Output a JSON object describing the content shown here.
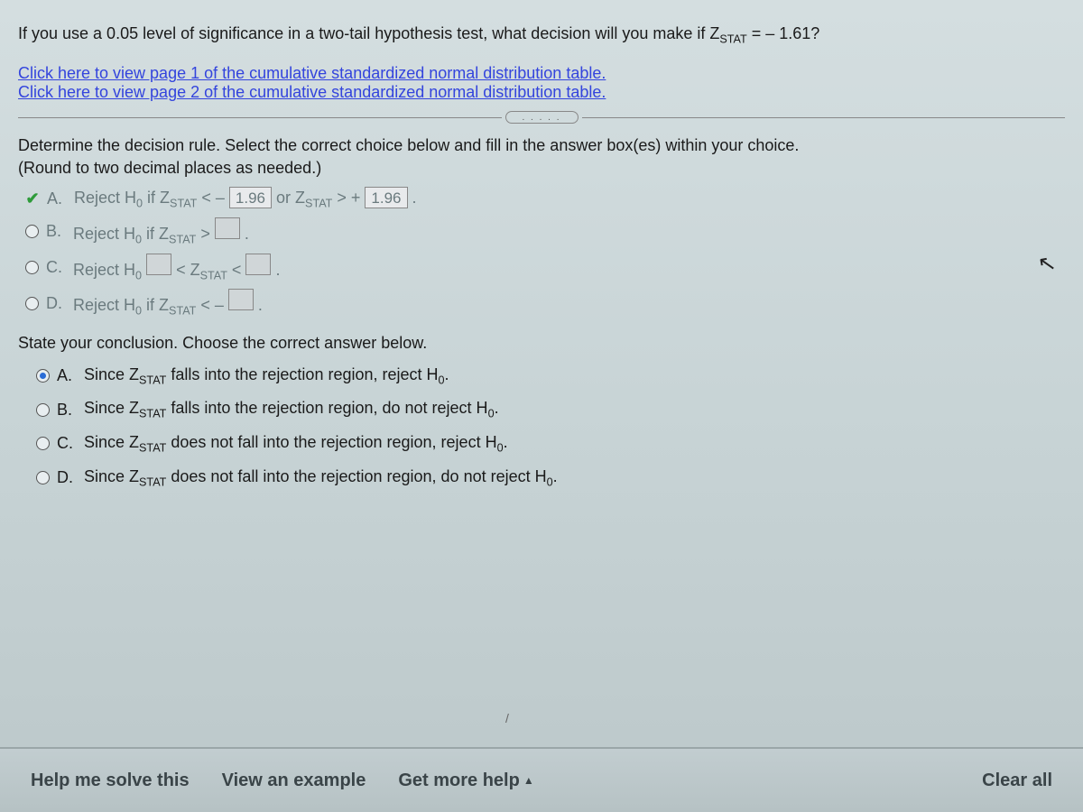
{
  "prompt": {
    "prefix": "If you use a 0.05 level of significance in a two-tail hypothesis test, what decision will you make if Z",
    "z_sub": "STAT",
    "suffix": " = – 1.61?"
  },
  "links": {
    "page1": "Click here to view page 1 of the cumulative standardized normal distribution table.",
    "page2": "Click here to view page 2 of the cumulative standardized normal distribution table."
  },
  "divider_dots": ". . . . .",
  "instruction1": "Determine the decision rule. Select the correct choice below and fill in the answer box(es) within your choice.",
  "instruction2": "(Round to two decimal places as needed.)",
  "q1": {
    "a": {
      "letter": "A.",
      "t1": "Reject H",
      "sub0": "0",
      "t2": " if Z",
      "zsub": "STAT",
      "t3": " < –",
      "val1": "1.96",
      "t4": " or Z",
      "t5": " > +",
      "val2": "1.96",
      "tail": " ."
    },
    "b": {
      "letter": "B.",
      "t1": "Reject H",
      "sub0": "0",
      "t2": " if Z",
      "zsub": "STAT",
      "t3": " > ",
      "tail": " ."
    },
    "c": {
      "letter": "C.",
      "t1": "Reject H",
      "sub0": "0",
      "t2": "  ",
      "t3": " < Z",
      "zsub": "STAT",
      "t4": " < ",
      "tail": " ."
    },
    "d": {
      "letter": "D.",
      "t1": "Reject H",
      "sub0": "0",
      "t2": " if Z",
      "zsub": "STAT",
      "t3": " < –",
      "tail": " ."
    }
  },
  "conclusion_head": "State your conclusion. Choose the correct answer below.",
  "q2": {
    "a": {
      "letter": "A.",
      "t1": "Since Z",
      "zsub": "STAT",
      "t2": " falls into the rejection region, reject H",
      "sub0": "0",
      "tail": "."
    },
    "b": {
      "letter": "B.",
      "t1": "Since Z",
      "zsub": "STAT",
      "t2": " falls into the rejection region, do not reject H",
      "sub0": "0",
      "tail": "."
    },
    "c": {
      "letter": "C.",
      "t1": "Since Z",
      "zsub": "STAT",
      "t2": " does not fall into the rejection region, reject H",
      "sub0": "0",
      "tail": "."
    },
    "d": {
      "letter": "D.",
      "t1": "Since Z",
      "zsub": "STAT",
      "t2": " does not fall into the rejection region, do not reject H",
      "sub0": "0",
      "tail": "."
    }
  },
  "bottom": {
    "help": "Help me solve this",
    "example": "View an example",
    "more": "Get more help",
    "clear": "Clear all"
  }
}
